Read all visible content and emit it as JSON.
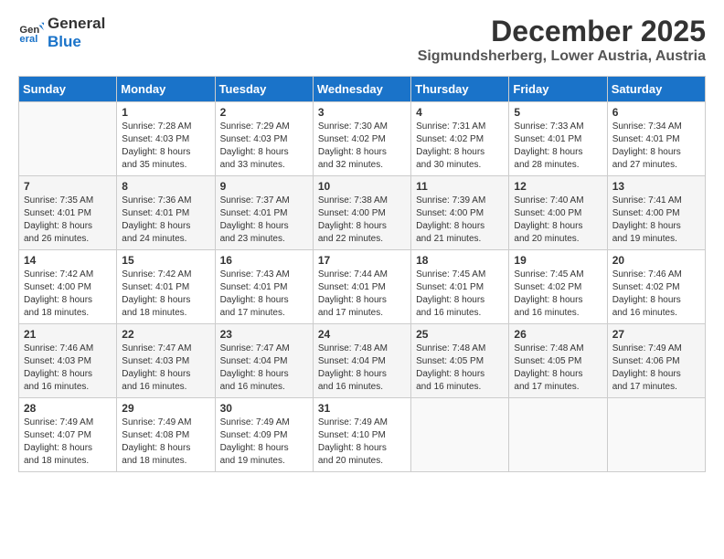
{
  "logo": {
    "line1": "General",
    "line2": "Blue"
  },
  "title": "December 2025",
  "location": "Sigmundsherberg, Lower Austria, Austria",
  "days_of_week": [
    "Sunday",
    "Monday",
    "Tuesday",
    "Wednesday",
    "Thursday",
    "Friday",
    "Saturday"
  ],
  "weeks": [
    [
      {
        "day": "",
        "content": ""
      },
      {
        "day": "1",
        "content": "Sunrise: 7:28 AM\nSunset: 4:03 PM\nDaylight: 8 hours\nand 35 minutes."
      },
      {
        "day": "2",
        "content": "Sunrise: 7:29 AM\nSunset: 4:03 PM\nDaylight: 8 hours\nand 33 minutes."
      },
      {
        "day": "3",
        "content": "Sunrise: 7:30 AM\nSunset: 4:02 PM\nDaylight: 8 hours\nand 32 minutes."
      },
      {
        "day": "4",
        "content": "Sunrise: 7:31 AM\nSunset: 4:02 PM\nDaylight: 8 hours\nand 30 minutes."
      },
      {
        "day": "5",
        "content": "Sunrise: 7:33 AM\nSunset: 4:01 PM\nDaylight: 8 hours\nand 28 minutes."
      },
      {
        "day": "6",
        "content": "Sunrise: 7:34 AM\nSunset: 4:01 PM\nDaylight: 8 hours\nand 27 minutes."
      }
    ],
    [
      {
        "day": "7",
        "content": "Sunrise: 7:35 AM\nSunset: 4:01 PM\nDaylight: 8 hours\nand 26 minutes."
      },
      {
        "day": "8",
        "content": "Sunrise: 7:36 AM\nSunset: 4:01 PM\nDaylight: 8 hours\nand 24 minutes."
      },
      {
        "day": "9",
        "content": "Sunrise: 7:37 AM\nSunset: 4:01 PM\nDaylight: 8 hours\nand 23 minutes."
      },
      {
        "day": "10",
        "content": "Sunrise: 7:38 AM\nSunset: 4:00 PM\nDaylight: 8 hours\nand 22 minutes."
      },
      {
        "day": "11",
        "content": "Sunrise: 7:39 AM\nSunset: 4:00 PM\nDaylight: 8 hours\nand 21 minutes."
      },
      {
        "day": "12",
        "content": "Sunrise: 7:40 AM\nSunset: 4:00 PM\nDaylight: 8 hours\nand 20 minutes."
      },
      {
        "day": "13",
        "content": "Sunrise: 7:41 AM\nSunset: 4:00 PM\nDaylight: 8 hours\nand 19 minutes."
      }
    ],
    [
      {
        "day": "14",
        "content": "Sunrise: 7:42 AM\nSunset: 4:00 PM\nDaylight: 8 hours\nand 18 minutes."
      },
      {
        "day": "15",
        "content": "Sunrise: 7:42 AM\nSunset: 4:01 PM\nDaylight: 8 hours\nand 18 minutes."
      },
      {
        "day": "16",
        "content": "Sunrise: 7:43 AM\nSunset: 4:01 PM\nDaylight: 8 hours\nand 17 minutes."
      },
      {
        "day": "17",
        "content": "Sunrise: 7:44 AM\nSunset: 4:01 PM\nDaylight: 8 hours\nand 17 minutes."
      },
      {
        "day": "18",
        "content": "Sunrise: 7:45 AM\nSunset: 4:01 PM\nDaylight: 8 hours\nand 16 minutes."
      },
      {
        "day": "19",
        "content": "Sunrise: 7:45 AM\nSunset: 4:02 PM\nDaylight: 8 hours\nand 16 minutes."
      },
      {
        "day": "20",
        "content": "Sunrise: 7:46 AM\nSunset: 4:02 PM\nDaylight: 8 hours\nand 16 minutes."
      }
    ],
    [
      {
        "day": "21",
        "content": "Sunrise: 7:46 AM\nSunset: 4:03 PM\nDaylight: 8 hours\nand 16 minutes."
      },
      {
        "day": "22",
        "content": "Sunrise: 7:47 AM\nSunset: 4:03 PM\nDaylight: 8 hours\nand 16 minutes."
      },
      {
        "day": "23",
        "content": "Sunrise: 7:47 AM\nSunset: 4:04 PM\nDaylight: 8 hours\nand 16 minutes."
      },
      {
        "day": "24",
        "content": "Sunrise: 7:48 AM\nSunset: 4:04 PM\nDaylight: 8 hours\nand 16 minutes."
      },
      {
        "day": "25",
        "content": "Sunrise: 7:48 AM\nSunset: 4:05 PM\nDaylight: 8 hours\nand 16 minutes."
      },
      {
        "day": "26",
        "content": "Sunrise: 7:48 AM\nSunset: 4:05 PM\nDaylight: 8 hours\nand 17 minutes."
      },
      {
        "day": "27",
        "content": "Sunrise: 7:49 AM\nSunset: 4:06 PM\nDaylight: 8 hours\nand 17 minutes."
      }
    ],
    [
      {
        "day": "28",
        "content": "Sunrise: 7:49 AM\nSunset: 4:07 PM\nDaylight: 8 hours\nand 18 minutes."
      },
      {
        "day": "29",
        "content": "Sunrise: 7:49 AM\nSunset: 4:08 PM\nDaylight: 8 hours\nand 18 minutes."
      },
      {
        "day": "30",
        "content": "Sunrise: 7:49 AM\nSunset: 4:09 PM\nDaylight: 8 hours\nand 19 minutes."
      },
      {
        "day": "31",
        "content": "Sunrise: 7:49 AM\nSunset: 4:10 PM\nDaylight: 8 hours\nand 20 minutes."
      },
      {
        "day": "",
        "content": ""
      },
      {
        "day": "",
        "content": ""
      },
      {
        "day": "",
        "content": ""
      }
    ]
  ]
}
